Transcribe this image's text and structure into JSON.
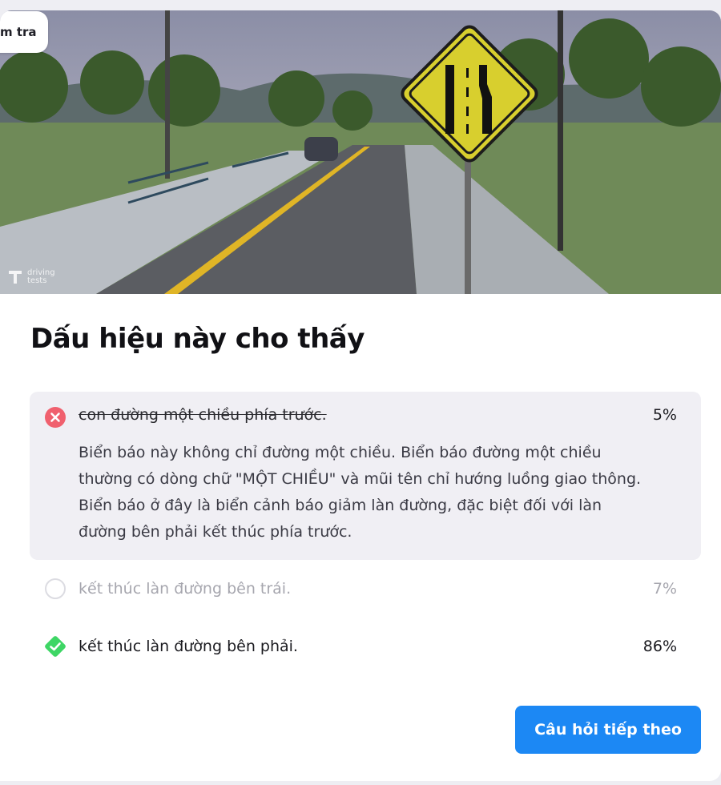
{
  "tab": {
    "label": "m tra"
  },
  "image": {
    "watermark_line1": "driving",
    "watermark_line2": "tests"
  },
  "question": {
    "title": "Dấu hiệu này cho thấy"
  },
  "answers": [
    {
      "label": "con đường một chiều phía trước.",
      "percent": "5%",
      "state": "wrong",
      "icon": "x-circle-icon",
      "explanation": "Biển báo này không chỉ đường một chiều. Biển báo đường một chiều thường có dòng chữ \"MỘT CHIỀU\" và mũi tên chỉ hướng luồng giao thông. Biển báo ở đây là biển cảnh báo giảm làn đường, đặc biệt đối với làn đường bên phải kết thúc phía trước."
    },
    {
      "label": "kết thúc làn đường bên trái.",
      "percent": "7%",
      "state": "unselected",
      "icon": "empty-circle-icon"
    },
    {
      "label": "kết thúc làn đường bên phải.",
      "percent": "86%",
      "state": "correct",
      "icon": "check-diamond-icon"
    }
  ],
  "next_button": {
    "label": "Câu hỏi tiếp theo"
  },
  "colors": {
    "accent": "#1c88f4",
    "wrong": "#f0606e",
    "correct": "#3ed665",
    "sign": "#d8cf2e"
  }
}
